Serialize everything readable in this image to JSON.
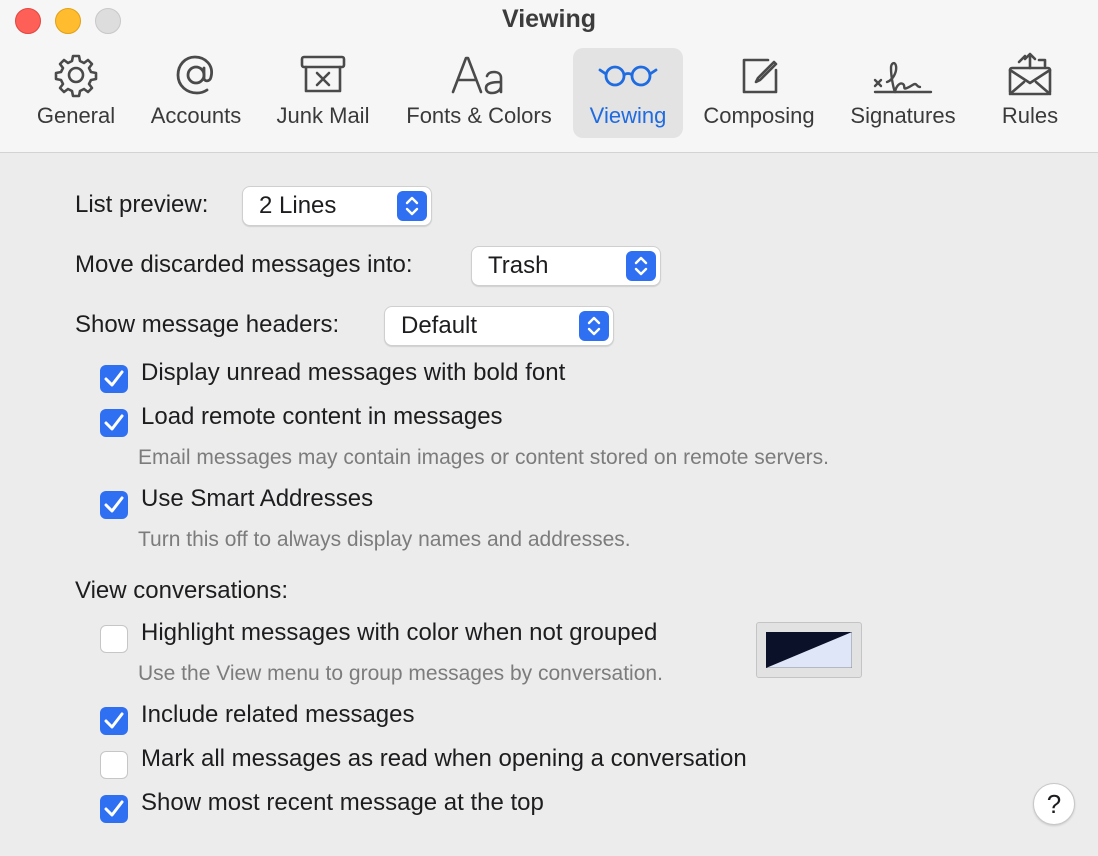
{
  "window": {
    "title": "Viewing"
  },
  "tabs": [
    {
      "label": "General",
      "icon": "gear-icon"
    },
    {
      "label": "Accounts",
      "icon": "at-icon"
    },
    {
      "label": "Junk Mail",
      "icon": "junk-mail-icon"
    },
    {
      "label": "Fonts & Colors",
      "icon": "fonts-icon"
    },
    {
      "label": "Viewing",
      "icon": "glasses-icon",
      "selected": true
    },
    {
      "label": "Composing",
      "icon": "compose-icon"
    },
    {
      "label": "Signatures",
      "icon": "signature-icon"
    },
    {
      "label": "Rules",
      "icon": "rules-icon"
    }
  ],
  "list_preview": {
    "label": "List preview:",
    "value": "2 Lines"
  },
  "discarded": {
    "label": "Move discarded messages into:",
    "value": "Trash"
  },
  "headers": {
    "label": "Show message headers:",
    "value": "Default"
  },
  "options": {
    "bold_unread": {
      "label": "Display unread messages with bold font",
      "checked": true
    },
    "remote_content": {
      "label": "Load remote content in messages",
      "checked": true,
      "note": "Email messages may contain images or content stored on remote servers."
    },
    "smart_addresses": {
      "label": "Use Smart Addresses",
      "checked": true,
      "note": "Turn this off to always display names and addresses."
    }
  },
  "conversations": {
    "label": "View conversations:",
    "highlight": {
      "label": "Highlight messages with color when not grouped",
      "checked": false,
      "note": "Use the View menu to group messages by conversation."
    },
    "include_related": {
      "label": "Include related messages",
      "checked": true
    },
    "mark_read": {
      "label": "Mark all messages as read when opening a conversation",
      "checked": false
    },
    "recent_top": {
      "label": "Show most recent message at the top",
      "checked": true
    }
  },
  "help": {
    "label": "?"
  },
  "colors": {
    "accent": "#2f6ff2",
    "selected_tab_text": "#1f6be0",
    "swatch_dark": "#0a1128",
    "swatch_light": "#dfe6f7"
  }
}
